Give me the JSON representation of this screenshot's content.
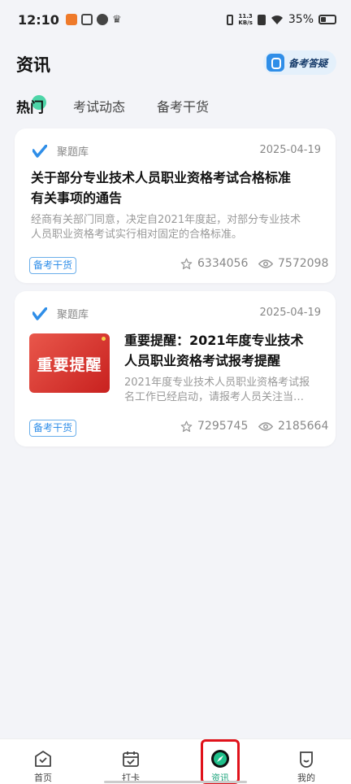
{
  "status_bar": {
    "time": "12:10",
    "net_speed_value": "11.3",
    "net_speed_unit": "KB/s",
    "battery": "35%"
  },
  "header": {
    "title": "资讯",
    "help_button": "备考答疑"
  },
  "tabs": [
    {
      "label": "热门",
      "active": true
    },
    {
      "label": "考试动态",
      "active": false
    },
    {
      "label": "备考干货",
      "active": false
    }
  ],
  "articles": [
    {
      "source": "聚题库",
      "date": "2025-04-19",
      "title_line1": "关于部分专业技术人员职业资格考试合格标准",
      "title_line2": "有关事项的通告",
      "desc_line1": "经商有关部门同意，决定自2021年度起，对部分专业技术",
      "desc_line2": "人员职业资格考试实行相对固定的合格标准。",
      "tag": "备考干货",
      "favorites": "6334056",
      "views": "7572098"
    },
    {
      "source": "聚题库",
      "date": "2025-04-19",
      "thumb_text": "重要提醒",
      "title_line1": "重要提醒：2021年度专业技术",
      "title_line2": "人员职业资格考试报考提醒",
      "desc_line1": "2021年度专业技术人员职业资格考试报",
      "desc_line2": "名工作已经启动，请报考人员关注当…",
      "tag": "备考干货",
      "favorites": "7295745",
      "views": "2185664"
    }
  ],
  "bottom_nav": [
    {
      "label": "首页",
      "icon": "home-icon"
    },
    {
      "label": "打卡",
      "icon": "calendar-check-icon"
    },
    {
      "label": "资讯",
      "icon": "compass-icon",
      "active": true
    },
    {
      "label": "我的",
      "icon": "profile-icon"
    }
  ],
  "colors": {
    "accent_green": "#1aa37a",
    "tag_blue": "#2f8ee8",
    "highlight_red": "#e0121b",
    "background": "#f3f4f8"
  }
}
